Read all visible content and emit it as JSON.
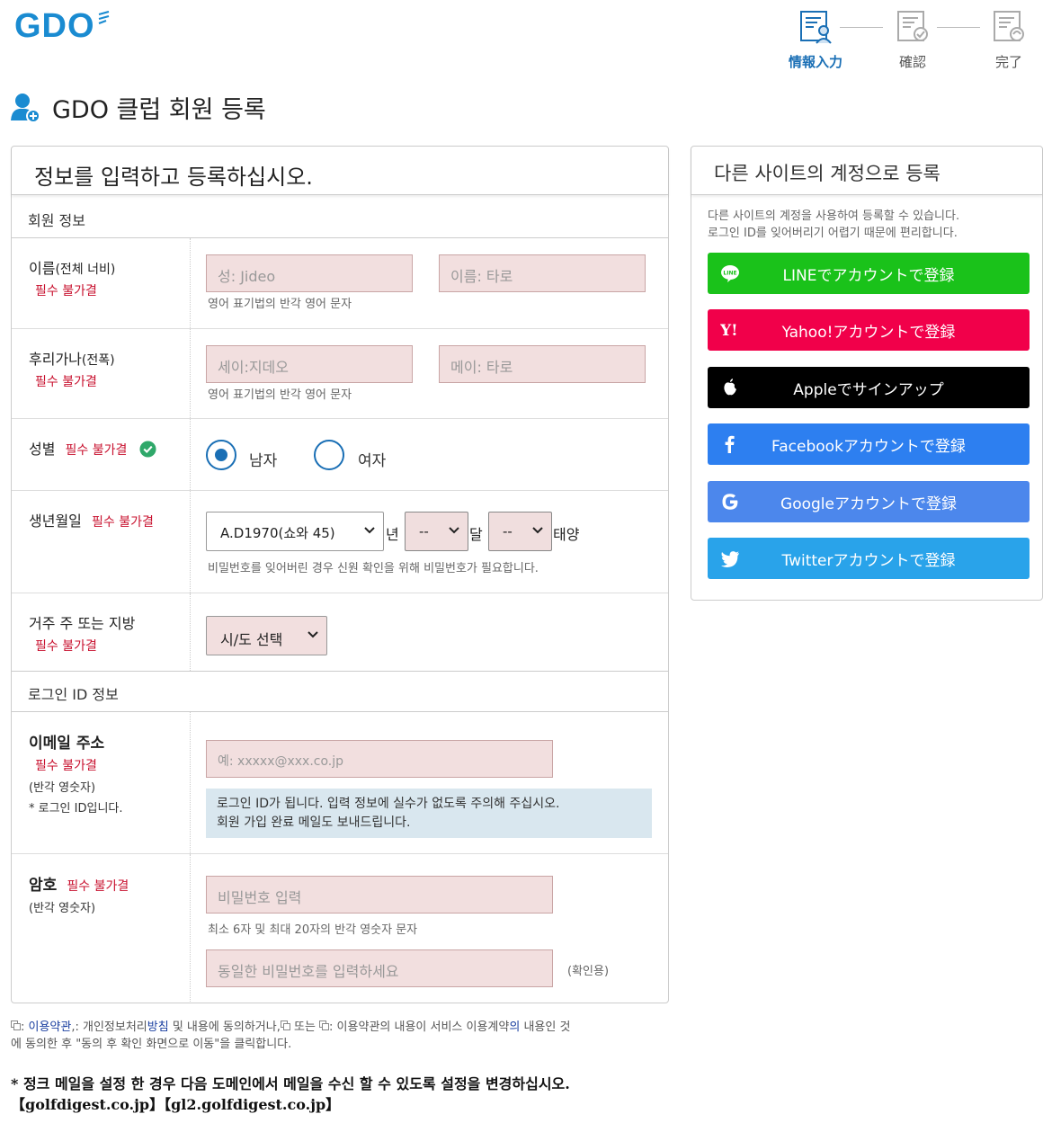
{
  "header": {
    "logo_text": "GDO",
    "steps": [
      {
        "label": "情報入力",
        "active": true
      },
      {
        "label": "確認",
        "active": false
      },
      {
        "label": "完了",
        "active": false
      }
    ],
    "page_title": "GDO 클럽 회원 등록"
  },
  "form": {
    "panel_title": "정보를 입력하고 등록하십시오.",
    "member_section": "회원 정보",
    "name": {
      "label": "이름",
      "label_sub": "(전체 너비)",
      "required": "필수 불가결",
      "last_placeholder": "성: Jideo",
      "first_placeholder": "이름: 타로",
      "hint": "영어 표기법의 반각 영어 문자"
    },
    "furigana": {
      "label": "후리가나",
      "label_sub": "(전폭)",
      "required": "필수 불가결",
      "last_placeholder": "세이:지데오",
      "first_placeholder": "메이: 타로",
      "hint": "영어 표기법의 반각 영어 문자"
    },
    "gender": {
      "label": "성별",
      "required": "필수 불가결",
      "options": [
        "남자",
        "여자"
      ],
      "selected": "남자"
    },
    "birthdate": {
      "label": "생년월일",
      "required": "필수 불가결",
      "year_value": "A.D1970(쇼와 45)",
      "year_unit": "년",
      "month_value": "--",
      "month_unit": "달",
      "day_value": "--",
      "day_unit": "태양",
      "hint": "비밀번호를 잊어버린 경우 신원 확인을 위해 비밀번호가 필요합니다."
    },
    "region": {
      "label": "거주 주 또는 지방",
      "required": "필수 불가결",
      "value": "시/도 선택"
    },
    "login_section": "로그인 ID 정보",
    "email": {
      "label": "이메일 주소",
      "required": "필수 불가결",
      "note1": "(반각 영숫자)",
      "note2": "* 로그인 ID입니다.",
      "placeholder": "예: xxxxx@xxx.co.jp",
      "info_line1": "로그인 ID가 됩니다. 입력 정보에 실수가 없도록 주의해 주십시오.",
      "info_line2": "회원 가입 완료 메일도 보내드립니다."
    },
    "password": {
      "label": "암호",
      "required": "필수 불가결",
      "note": "(반각 영숫자)",
      "placeholder": "비밀번호 입력",
      "hint": "최소 6자 및 최대 20자의 반각 영숫자 문자",
      "confirm_placeholder": "동일한 비밀번호를 입력하세요",
      "confirm_note": "(확인용)"
    }
  },
  "social": {
    "title": "다른 사이트의 계정으로 등록",
    "desc_line1": "다른 사이트의 계정을 사용하여 등록할 수 있습니다.",
    "desc_line2": "로그인 ID를 잊어버리기 어렵기 때문에 편리합니다.",
    "buttons": [
      {
        "label": "LINEでアカウントで登録",
        "icon": "line-icon",
        "color": "#1ac21a"
      },
      {
        "label": "Yahoo!アカウントで登録",
        "icon": "yahoo-icon",
        "color": "#f1004a"
      },
      {
        "label": "Appleでサインアップ",
        "icon": "apple-icon",
        "color": "#000000"
      },
      {
        "label": "Facebookアカウントで登録",
        "icon": "facebook-icon",
        "color": "#2d7ff0"
      },
      {
        "label": "Googleアカウントで登録",
        "icon": "google-icon",
        "color": "#4c87ec"
      },
      {
        "label": "Twitterアカウントで登録",
        "icon": "twitter-icon",
        "color": "#29a3ea"
      }
    ]
  },
  "footer": {
    "terms_link": "이용약관",
    "privacy_link": "방침",
    "agree_a": ": ",
    "agree_b": ",: 개인정보처리",
    "agree_c": " 및 내용에 동의하거나,",
    "agree_d": " 또는 ",
    "agree_e": ": 이용약관의 내용이 서비스 이용계약",
    "contract_link": "의",
    "agree_f": " 내용인 것",
    "agree_line2": "에 동의한 후 \"동의 후 확인 화면으로 이동\"을 클릭합니다.",
    "mail_notice": "* 정크 메일을 설정 한 경우 다음 도메인에서 메일을 수신 할 수 있도록 설정을 변경하십시오.",
    "domains": "【golfdigest.co.jp】【gl2.golfdigest.co.jp】"
  }
}
